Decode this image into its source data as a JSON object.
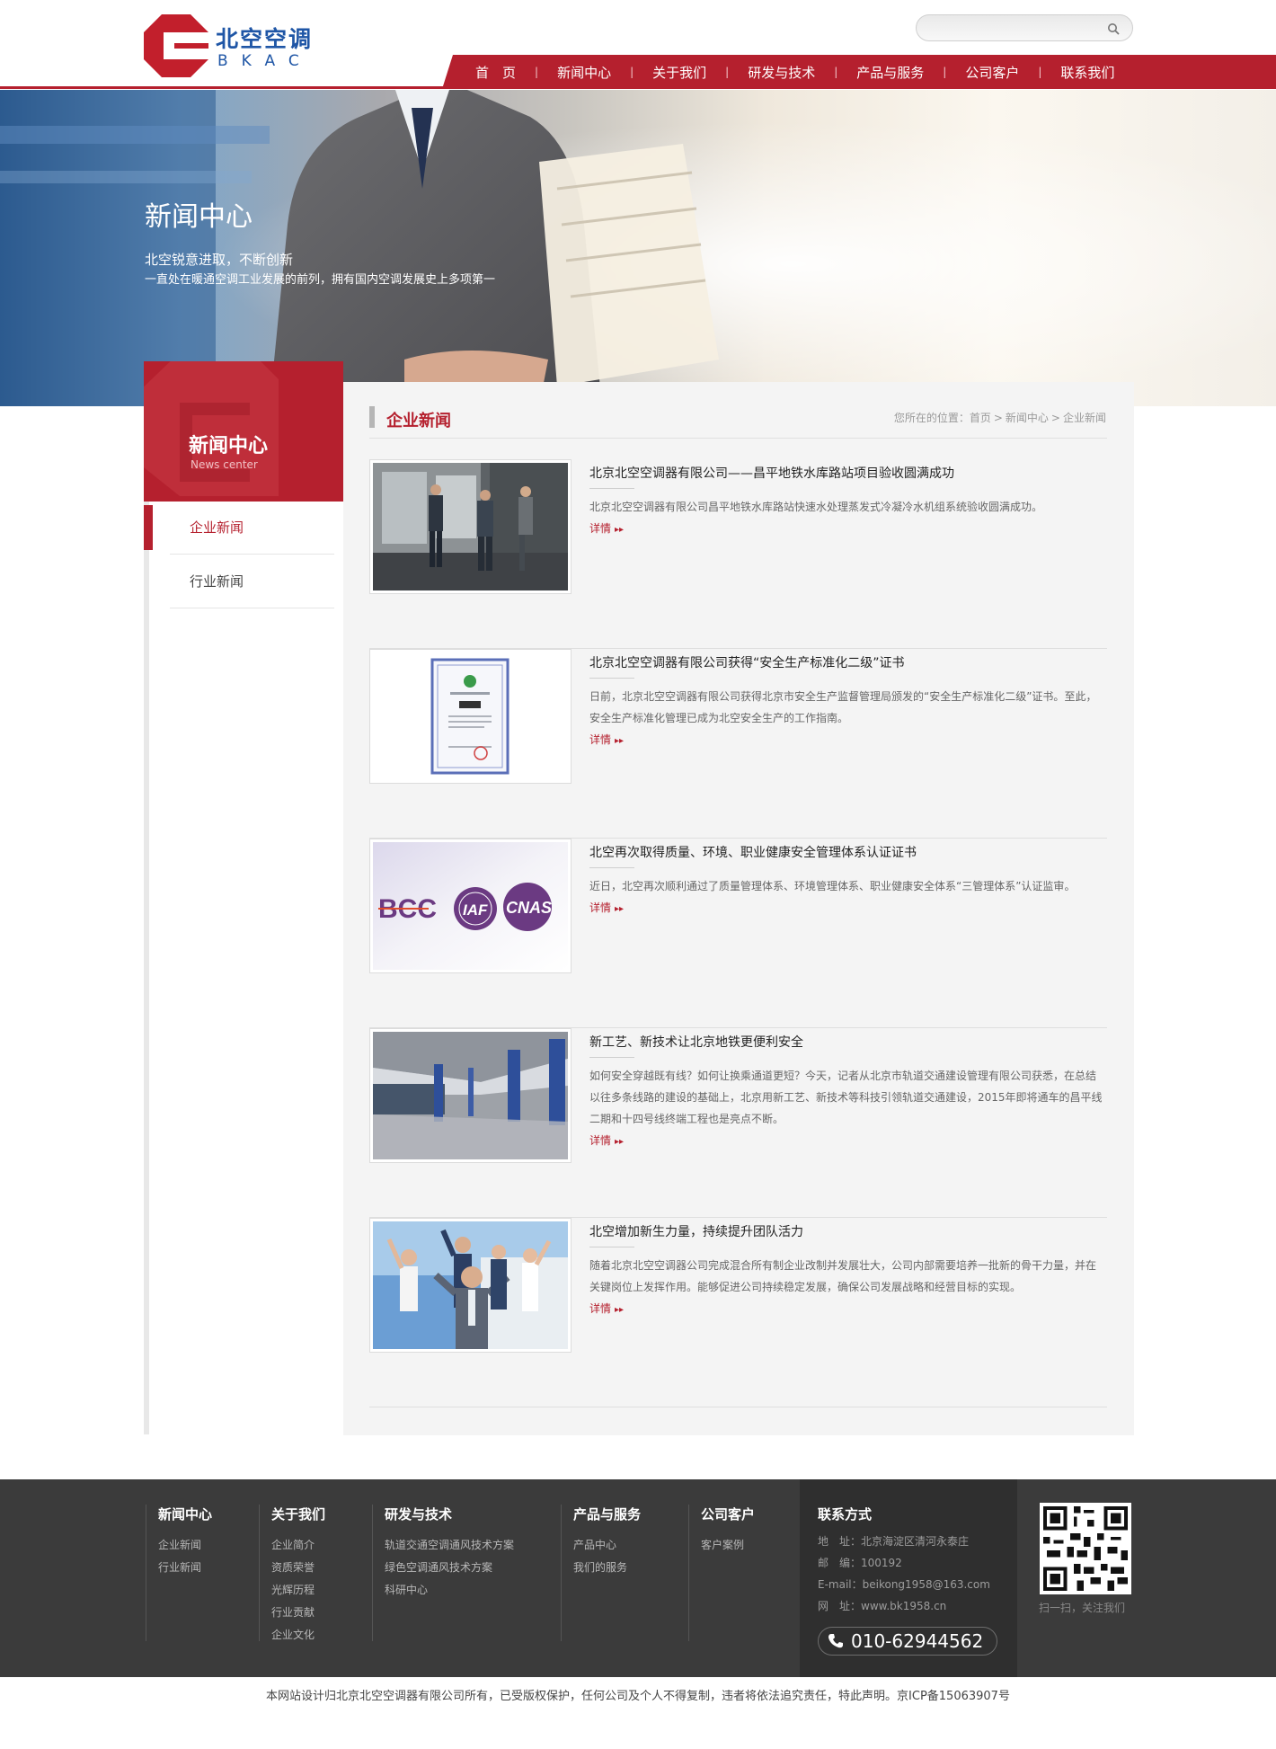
{
  "colors": {
    "brand_red": "#b5202e",
    "brand_blue": "#1f56a6",
    "footer_bg": "#3b3b3b"
  },
  "header": {
    "logo_cn": "北空空调",
    "logo_en": "BKAC",
    "search_placeholder": "",
    "nav": [
      "首　页",
      "新闻中心",
      "关于我们",
      "研发与技术",
      "产品与服务",
      "公司客户",
      "联系我们"
    ]
  },
  "banner": {
    "title": "新闻中心",
    "subtitle": "北空锐意进取，不断创新",
    "tagline": "一直处在暖通空调工业发展的前列，拥有国内空调发展史上多项第一"
  },
  "sidebar": {
    "title": "新闻中心",
    "title_en": "News center",
    "items": [
      {
        "label": "企业新闻",
        "active": true
      },
      {
        "label": "行业新闻",
        "active": false
      }
    ]
  },
  "main": {
    "section_title": "企业新闻",
    "breadcrumb": {
      "prefix": "您所在的位置：",
      "home": "首页",
      "sep": ">",
      "level1": "新闻中心",
      "level2": "企业新闻"
    },
    "more_label": "详情",
    "news": [
      {
        "title": "北京北空空调器有限公司——昌平地铁水库路站项目验收圆满成功",
        "summary": "北京北空空调器有限公司昌平地铁水库路站快速水处理蒸发式冷凝冷水机组系统验收圆满成功。",
        "image": "workers-inspecting-equipment"
      },
      {
        "title": "北京北空空调器有限公司获得“安全生产标准化二级”证书",
        "summary": "日前，北京北空空调器有限公司获得北京市安全生产监督管理局颁发的“安全生产标准化二级”证书。至此，安全生产标准化管理已成为北空安全生产的工作指南。",
        "image": "safety-certificate"
      },
      {
        "title": "北空再次取得质量、环境、职业健康安全管理体系认证证书",
        "summary": "近日，北空再次顺利通过了质量管理体系、环境管理体系、职业健康安全体系“三管理体系”认证监审。",
        "image": "certification-logos",
        "logos": [
          "BCC",
          "IAF",
          "CNAS"
        ]
      },
      {
        "title": "新工艺、新技术让北京地铁更便利安全",
        "summary": "如何安全穿越既有线？如何让换乘通道更短？今天，记者从北京市轨道交通建设管理有限公司获悉，在总结以往多条线路的建设的基础上，北京用新工艺、新技术等科技引领轨道交通建设，2015年即将通车的昌平线二期和十四号线终端工程也是亮点不断。",
        "image": "subway-station"
      },
      {
        "title": "北空增加新生力量，持续提升团队活力",
        "summary": "随着北京北空空调器公司完成混合所有制企业改制并发展壮大，公司内部需要培养一批新的骨干力量，并在关键岗位上发挥作用。能够促进公司持续稳定发展，确保公司发展战略和经营目标的实现。",
        "image": "cheering-team"
      }
    ]
  },
  "footer": {
    "columns": [
      {
        "title": "新闻中心",
        "links": [
          "企业新闻",
          "行业新闻"
        ]
      },
      {
        "title": "关于我们",
        "links": [
          "企业简介",
          "资质荣誉",
          "光辉历程",
          "行业贡献",
          "企业文化"
        ]
      },
      {
        "title": "研发与技术",
        "links": [
          "轨道交通空调通风技术方案",
          "绿色空调通风技术方案",
          "科研中心"
        ]
      },
      {
        "title": "产品与服务",
        "links": [
          "产品中心",
          "我们的服务"
        ]
      },
      {
        "title": "公司客户",
        "links": [
          "客户案例"
        ]
      }
    ],
    "contact": {
      "title": "联系方式",
      "address": "地　址：北京海淀区清河永泰庄",
      "postcode": "邮　编：100192",
      "email": "E-mail：beikong1958@163.com",
      "website": "网　址：www.bk1958.cn",
      "phone": "010-62944562"
    },
    "qr_caption": "扫一扫，关注我们",
    "copyright": "本网站设计归北京北空空调器有限公司所有，已受版权保护，任何公司及个人不得复制，违者将依法追究责任，特此声明。京ICP备15063907号"
  }
}
